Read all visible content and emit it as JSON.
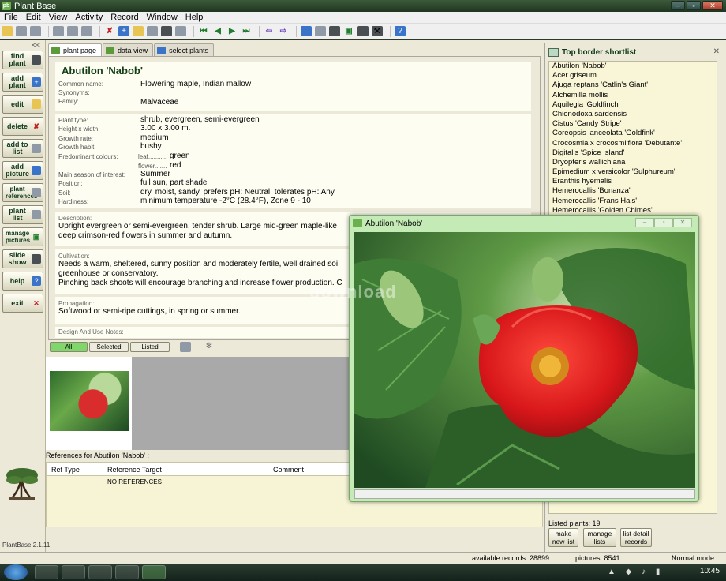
{
  "window": {
    "title": "Plant Base"
  },
  "menu": [
    "File",
    "Edit",
    "View",
    "Activity",
    "Record",
    "Window",
    "Help"
  ],
  "sidebar": {
    "buttons": [
      {
        "label": "find plant",
        "icon": "binoculars-icon"
      },
      {
        "label": "add plant",
        "icon": "plus-icon"
      },
      {
        "label": "edit",
        "icon": "pencil-icon"
      },
      {
        "label": "delete",
        "icon": "delete-icon"
      },
      {
        "label": "add to list",
        "icon": "add-to-list-icon"
      },
      {
        "label": "add picture",
        "icon": "add-picture-icon"
      },
      {
        "label": "plant references",
        "icon": "references-icon"
      },
      {
        "label": "plant list",
        "icon": "list-icon"
      },
      {
        "label": "manage pictures",
        "icon": "pictures-icon"
      },
      {
        "label": "slide show",
        "icon": "projector-icon"
      },
      {
        "label": "help",
        "icon": "help-icon"
      },
      {
        "label": "exit",
        "icon": "exit-icon"
      }
    ],
    "collapse": "<<",
    "version": "PlantBase 2.1.11"
  },
  "tabs": [
    {
      "label": "plant page",
      "active": true
    },
    {
      "label": "data view",
      "active": false
    },
    {
      "label": "select plants",
      "active": false
    }
  ],
  "plant": {
    "name": "Abutilon 'Nabob'",
    "common_label": "Common name:",
    "common_value": "Flowering maple, Indian mallow",
    "synonyms_label": "Synonyms:",
    "synonyms_value": "",
    "family_label": "Family:",
    "family_value": "Malvaceae",
    "type_label": "Plant type:",
    "type_value": "shrub, evergreen, semi-evergreen",
    "hw_label": "Height x width:",
    "hw_value": "3.00 x 3.00 m.",
    "growth_rate_label": "Growth rate:",
    "growth_rate_value": "medium",
    "habit_label": "Growth habit:",
    "habit_value": "bushy",
    "colours_label": "Predominant colours:",
    "leaf_label": "leaf..........",
    "leaf_value": "green",
    "flower_label": "flower.......",
    "flower_value": "red",
    "season_label": "Main season of interest:",
    "season_value": "Summer",
    "position_label": "Position:",
    "position_value": "full sun, part shade",
    "soil_label": "Soil:",
    "soil_value": "dry, moist, sandy, prefers pH: Neutral, tolerates pH: Any",
    "hardiness_label": "Hardiness:",
    "hardiness_value": "minimum temperature -2°C (28.4°F), Zone 9 - 10",
    "description_label": "Description:",
    "description_line1": "Upright evergreen or semi-evergreen, tender shrub. Large mid-green maple-like",
    "description_line2": "deep crimson-red flowers in summer and autumn.",
    "cultivation_label": "Cultivation:",
    "cultivation_line1": "Needs a warm, sheltered, sunny position and moderately fertile, well drained soi",
    "cultivation_line2": "greenhouse or conservatory.",
    "cultivation_line3": "Pinching back shoots will encourage branching and increase flower production. C",
    "propagation_label": "Propagation:",
    "propagation_value": "Softwood or semi-ripe cuttings, in spring or summer.",
    "design_label": "Design And Use Notes:"
  },
  "filter": {
    "all": "All",
    "selected": "Selected",
    "listed": "Listed"
  },
  "references": {
    "title": "References for Abutilon 'Nabob' :",
    "col_ref_type": "Ref Type",
    "col_target": "Reference Target",
    "col_comment": "Comment",
    "empty": "NO REFERENCES"
  },
  "shortlist": {
    "title": "Top border shortlist",
    "items": [
      "Abutilon 'Nabob'",
      "Acer griseum",
      "Ajuga reptans 'Catlin's Giant'",
      "Alchemilla mollis",
      "Aquilegia 'Goldfinch'",
      "Chionodoxa sardensis",
      "Cistus 'Candy Stripe'",
      "Coreopsis lanceolata 'Goldfink'",
      "Crocosmia x crocosmiiflora 'Debutante'",
      "Digitalis 'Spice Island'",
      "Dryopteris wallichiana",
      "Epimedium x versicolor 'Sulphureum'",
      "Eranthis hyemalis",
      "Hemerocallis 'Bonanza'",
      "Hemerocallis 'Frans Hals'",
      "Hemerocallis 'Golden Chimes'"
    ],
    "count": "Listed plants: 19",
    "btn_new": "make new list",
    "btn_manage": "manage lists",
    "btn_detail": "list detail records"
  },
  "status": {
    "records": "available records: 28899",
    "pictures": "pictures: 8541",
    "mode": "Normal mode"
  },
  "picture_window": {
    "title": "Abutilon 'Nabob'"
  },
  "watermark": "download",
  "taskbar": {
    "time": "10:45"
  },
  "colors": {
    "active_filter": "#7fd66a",
    "title_green": "#123d15",
    "list_bg": "#f9f5d7"
  }
}
